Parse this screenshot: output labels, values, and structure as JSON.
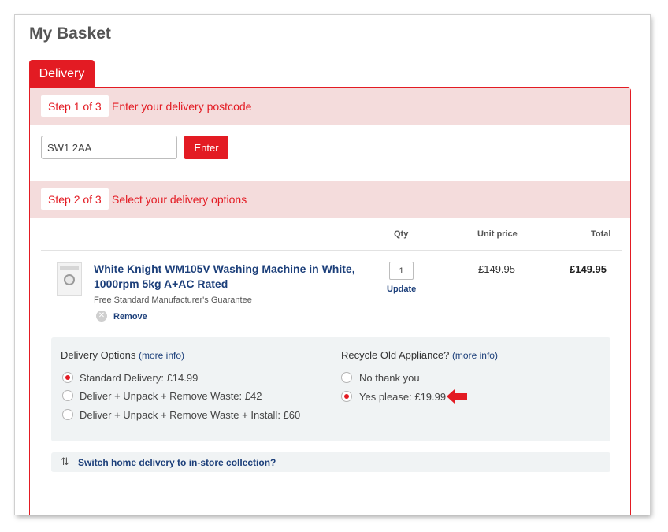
{
  "page": {
    "title": "My Basket"
  },
  "tab": {
    "label": "Delivery"
  },
  "step1": {
    "badge": "Step 1 of 3",
    "text": "Enter your delivery postcode"
  },
  "postcode": {
    "value": "SW1 2AA",
    "enter_label": "Enter"
  },
  "step2": {
    "badge": "Step 2 of 3",
    "text": "Select your delivery options"
  },
  "table": {
    "headers": {
      "qty": "Qty",
      "unit_price": "Unit price",
      "total": "Total"
    }
  },
  "product": {
    "title": "White Knight WM105V Washing Machine in White, 1000rpm 5kg A+AC Rated",
    "guarantee": "Free Standard Manufacturer's Guarantee",
    "remove_label": "Remove",
    "qty": "1",
    "update_label": "Update",
    "unit_price": "£149.95",
    "total": "£149.95"
  },
  "delivery_options": {
    "heading": "Delivery Options",
    "more_info": "(more info)",
    "options": [
      {
        "label": "Standard Delivery: £14.99",
        "checked": true
      },
      {
        "label": "Deliver + Unpack + Remove Waste: £42",
        "checked": false
      },
      {
        "label": "Deliver + Unpack + Remove Waste + Install: £60",
        "checked": false
      }
    ]
  },
  "recycle": {
    "heading": "Recycle Old Appliance?",
    "more_info": "(more info)",
    "options": [
      {
        "label": "No thank you",
        "checked": false
      },
      {
        "label": "Yes please: £19.99",
        "checked": true
      }
    ]
  },
  "switch": {
    "label": "Switch home delivery to in-store collection?"
  },
  "colors": {
    "accent": "#e31b23",
    "link": "#1c3f7a",
    "step_bg": "#f4dcdc",
    "options_bg": "#f0f3f4"
  },
  "icons": {
    "remove": "close-circle-icon",
    "switch": "swap-arrows-icon",
    "pointer": "red-arrow-icon"
  }
}
